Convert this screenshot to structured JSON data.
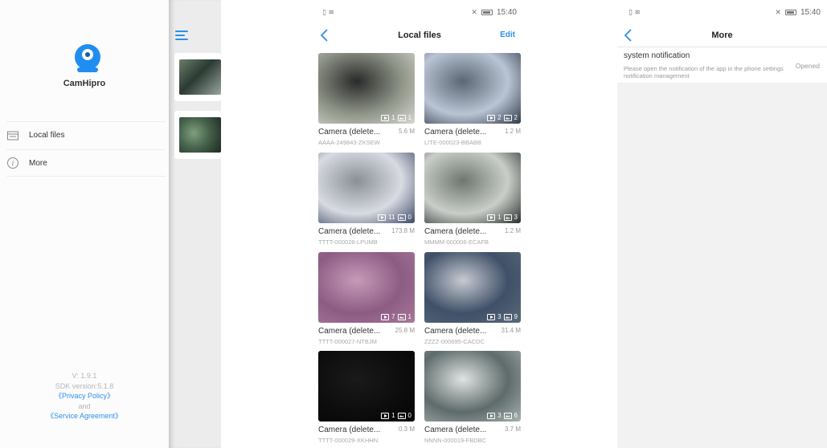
{
  "status_bar": {
    "left_glyphs": "▯ ≋",
    "right_glyphs": "✕",
    "time": "15:40"
  },
  "drawer": {
    "app_name": "CamHipro",
    "menu": [
      {
        "label": "Local files",
        "icon": "folder-icon"
      },
      {
        "label": "More",
        "icon": "info-icon"
      }
    ],
    "footer": {
      "version": "V: 1.9.1",
      "sdk_version": "SDK version:5.1.8",
      "privacy_policy": "《Privacy Policy》",
      "and": "and",
      "service_agreement": "《Service Agreement》"
    }
  },
  "local_files": {
    "title": "Local files",
    "edit_label": "Edit",
    "items": [
      {
        "name": "Camera (delete...",
        "size": "5.6 M",
        "id": "AAAA-249843-ZKSEW",
        "videos": "1",
        "photos": "1",
        "theme": "t1"
      },
      {
        "name": "Camera (delete...",
        "size": "1.2 M",
        "id": "LITE-000023-BBABB",
        "videos": "2",
        "photos": "2",
        "theme": "t2"
      },
      {
        "name": "Camera (delete...",
        "size": "173.8 M",
        "id": "TTTT-000028-LPUMB",
        "videos": "11",
        "photos": "0",
        "theme": "t3"
      },
      {
        "name": "Camera (delete...",
        "size": "1.2 M",
        "id": "MMMM-000006-ECAFB",
        "videos": "1",
        "photos": "3",
        "theme": "t4"
      },
      {
        "name": "Camera (delete...",
        "size": "25.8 M",
        "id": "TTTT-000027-NTBJM",
        "videos": "7",
        "photos": "1",
        "theme": "t5"
      },
      {
        "name": "Camera (delete...",
        "size": "31.4 M",
        "id": "ZZZZ-000695-CACDC",
        "videos": "3",
        "photos": "9",
        "theme": "t6"
      },
      {
        "name": "Camera (delete...",
        "size": "0.3 M",
        "id": "TTTT-000029-XKHHN",
        "videos": "1",
        "photos": "0",
        "theme": "t7"
      },
      {
        "name": "Camera (delete...",
        "size": "3.7 M",
        "id": "NNNN-000019-FBDBC",
        "videos": "3",
        "photos": "6",
        "theme": "t8"
      }
    ]
  },
  "more": {
    "title": "More",
    "notification": {
      "title": "system notification",
      "description": "Please open the notification of the app in the phone settings notification management",
      "status": "Opened"
    }
  },
  "thumb_colors": {
    "t1": [
      "#d7d7cf",
      "#8f9588",
      "#2a2a2a"
    ],
    "t2": [
      "#2f3a48",
      "#b9c4d4",
      "#5c6775"
    ],
    "t3": [
      "#3c4a66",
      "#d8dbe2",
      "#8a8f96"
    ],
    "t4": [
      "#2a2e2c",
      "#c9cec9",
      "#6f7670"
    ],
    "t5": [
      "#a7789a",
      "#8c5c83",
      "#c79ab8"
    ],
    "t6": [
      "#5a6b7a",
      "#3f5068",
      "#c7cbd1"
    ],
    "t7": [
      "#050505",
      "#0d0d0d",
      "#1a1a1a"
    ],
    "t8": [
      "#a9b2b0",
      "#5d6b6a",
      "#e0e4e3"
    ]
  }
}
